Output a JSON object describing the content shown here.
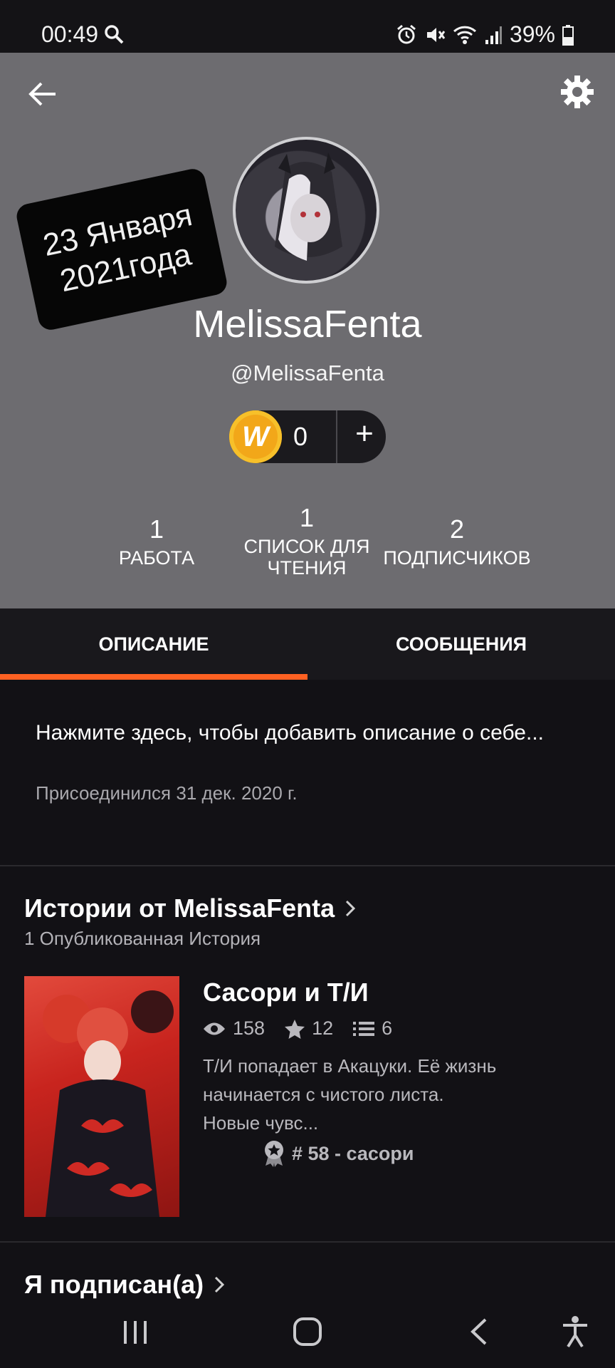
{
  "status_bar": {
    "time": "00:49",
    "battery": "39%"
  },
  "profile": {
    "sticker_line1": "23 Января",
    "sticker_line2": "2021года",
    "name": "MelissaFenta",
    "handle": "@MelissaFenta",
    "coins": "0",
    "coin_symbol": "W",
    "plus": "+"
  },
  "stats": [
    {
      "value": "1",
      "label": "РАБОТА"
    },
    {
      "value": "1",
      "label": "СПИСОК ДЛЯ ЧТЕНИЯ"
    },
    {
      "value": "2",
      "label": "ПОДПИСЧИКОВ"
    }
  ],
  "tabs": [
    {
      "label": "ОПИСАНИЕ",
      "active": true
    },
    {
      "label": "СООБЩЕНИЯ",
      "active": false
    }
  ],
  "about": {
    "prompt": "Нажмите здесь, чтобы добавить описание о себе...",
    "joined": "Присоединился 31 дек. 2020 г."
  },
  "stories_section": {
    "title": "Истории от MelissaFenta",
    "subtitle": "1 Опубликованная История",
    "story": {
      "title": "Сасори и Т/И",
      "reads": "158",
      "votes": "12",
      "parts": "6",
      "description": "Т/И попадает в Акацуки. Её жизнь начинается с чистого листа. Новые чувс...",
      "rank": "# 58 - сасори"
    }
  },
  "following_section": {
    "title": "Я подписан(а)"
  },
  "colors": {
    "accent": "#ff6122",
    "header_bg": "#6d6c70",
    "body_bg": "#121115"
  }
}
